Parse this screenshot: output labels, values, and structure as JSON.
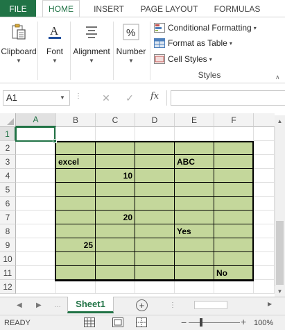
{
  "ribbon": {
    "tabs": [
      {
        "label": "FILE"
      },
      {
        "label": "HOME"
      },
      {
        "label": "INSERT"
      },
      {
        "label": "PAGE LAYOUT"
      },
      {
        "label": "FORMULAS"
      }
    ],
    "active_tab": "HOME",
    "groups": {
      "clipboard": "Clipboard",
      "font": "Font",
      "alignment": "Alignment",
      "number": "Number"
    },
    "styles": {
      "conditional_formatting": "Conditional Formatting",
      "format_as_table": "Format as Table",
      "cell_styles": "Cell Styles",
      "group_title": "Styles"
    }
  },
  "formula_bar": {
    "name_box": "A1",
    "fx": "fx",
    "formula": ""
  },
  "grid": {
    "columns": [
      "A",
      "B",
      "C",
      "D",
      "E",
      "F"
    ],
    "rows": [
      "1",
      "2",
      "3",
      "4",
      "5",
      "6",
      "7",
      "8",
      "9",
      "10",
      "11",
      "12"
    ],
    "selected_column": "A",
    "selected_row": "1",
    "fill_color": "#c4d79b",
    "cells": {
      "B3": "excel",
      "E3": "ABC",
      "C4": "10",
      "C7": "20",
      "E8": "Yes",
      "B9": "25",
      "F11": "No"
    }
  },
  "sheet_tabs": {
    "active": "Sheet1"
  },
  "status_bar": {
    "status": "READY",
    "zoom": "100%"
  },
  "colors": {
    "accent": "#217346"
  }
}
